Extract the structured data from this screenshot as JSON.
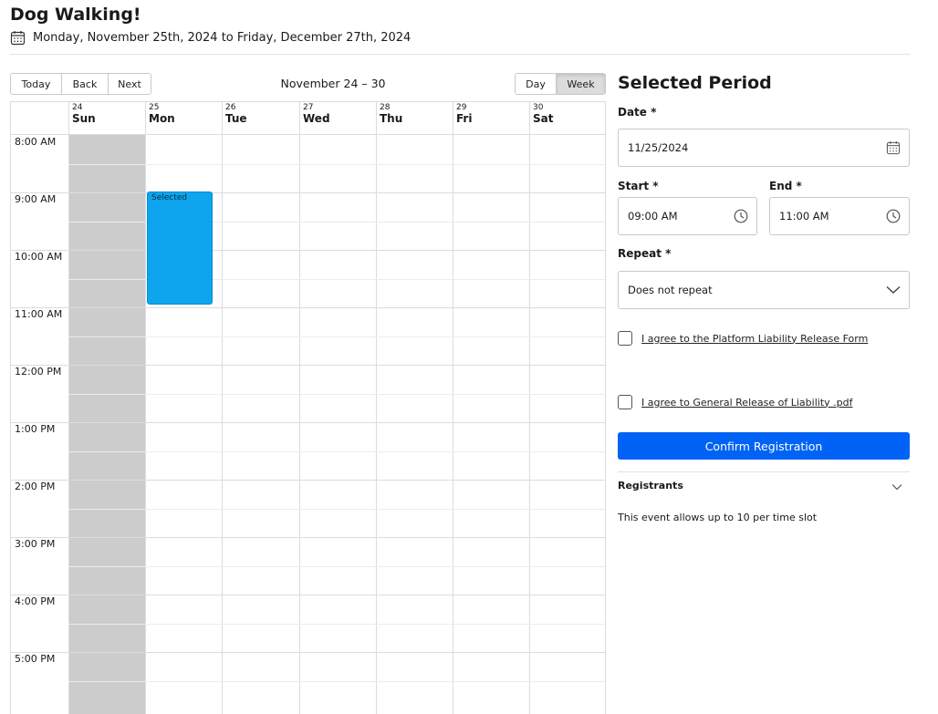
{
  "event": {
    "title": "Dog Walking!",
    "date_range": "Monday, November 25th, 2024 to Friday, December 27th, 2024"
  },
  "toolbar": {
    "today": "Today",
    "back": "Back",
    "next": "Next",
    "label": "November 24 – 30",
    "views": [
      "Day",
      "Week"
    ],
    "active_view": "Week"
  },
  "calendar": {
    "days": [
      {
        "num": "24",
        "name": "Sun",
        "closed": true
      },
      {
        "num": "25",
        "name": "Mon",
        "closed": false
      },
      {
        "num": "26",
        "name": "Tue",
        "closed": false
      },
      {
        "num": "27",
        "name": "Wed",
        "closed": false
      },
      {
        "num": "28",
        "name": "Thu",
        "closed": false
      },
      {
        "num": "29",
        "name": "Fri",
        "closed": false
      },
      {
        "num": "30",
        "name": "Sat",
        "closed": false
      }
    ],
    "times": [
      "8:00 AM",
      "9:00 AM",
      "10:00 AM",
      "11:00 AM",
      "12:00 PM",
      "1:00 PM",
      "2:00 PM",
      "3:00 PM",
      "4:00 PM",
      "5:00 PM"
    ],
    "selected_event": {
      "label": "Selected",
      "day": "Mon",
      "start": "9:00 AM",
      "end": "11:00 AM",
      "color": "#0ea5ee"
    }
  },
  "panel": {
    "title": "Selected Period",
    "date_label": "Date *",
    "date_value": "11/25/2024",
    "start_label": "Start *",
    "start_value": "09:00 AM",
    "end_label": "End *",
    "end_value": "11:00 AM",
    "repeat_label": "Repeat *",
    "repeat_value": "Does not repeat",
    "agree_platform": "I agree to the Platform Liability Release Form",
    "agree_general": "I agree to General Release of Liability .pdf",
    "confirm": "Confirm Registration",
    "registrants": "Registrants",
    "note": "This event allows up to 10 per time slot",
    "accent_color": "#0063f5"
  }
}
